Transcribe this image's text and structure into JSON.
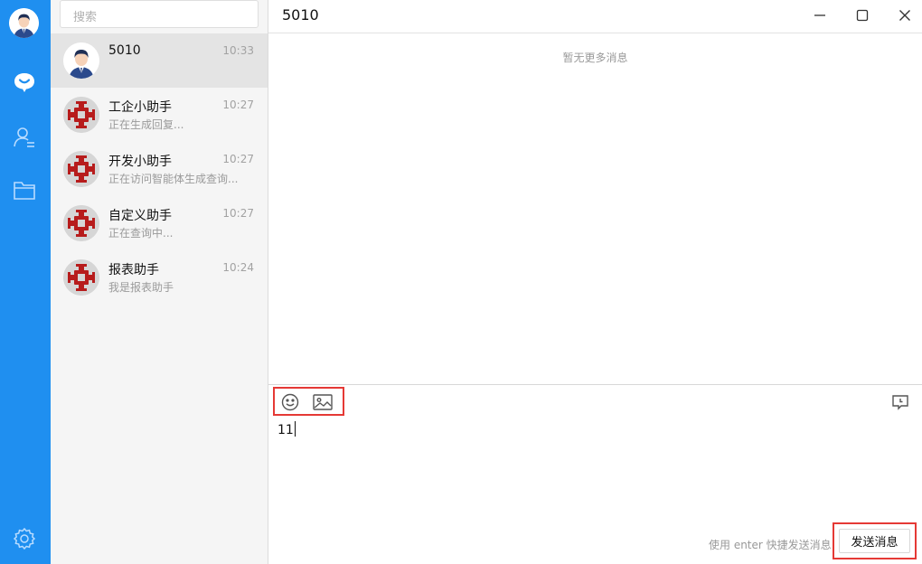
{
  "rail": {
    "icons": [
      "user-avatar",
      "chat-bubble-icon",
      "contacts-icon",
      "folder-icon",
      "gear-icon"
    ]
  },
  "search": {
    "placeholder": "搜索"
  },
  "sessions": [
    {
      "name": "5010",
      "preview": "",
      "time": "10:33",
      "active": true,
      "avatar": "user-avatar"
    },
    {
      "name": "工企小助手",
      "preview": "正在生成回复...",
      "time": "10:27",
      "active": false,
      "avatar": "assistant-logo"
    },
    {
      "name": "开发小助手",
      "preview": "正在访问智能体生成查询...",
      "time": "10:27",
      "active": false,
      "avatar": "assistant-logo"
    },
    {
      "name": "自定义助手",
      "preview": "正在查询中...",
      "time": "10:27",
      "active": false,
      "avatar": "assistant-logo"
    },
    {
      "name": "报表助手",
      "preview": "我是报表助手",
      "time": "10:24",
      "active": false,
      "avatar": "assistant-logo"
    }
  ],
  "chat": {
    "title": "5010",
    "no_more": "暂无更多消息",
    "input_value": "11",
    "hint": "使用 enter 快捷发送消息",
    "send_label": "发送消息"
  },
  "colors": {
    "rail_bg": "#1f8ff0",
    "highlight": "#e53935",
    "logo_red": "#b71c1c"
  }
}
